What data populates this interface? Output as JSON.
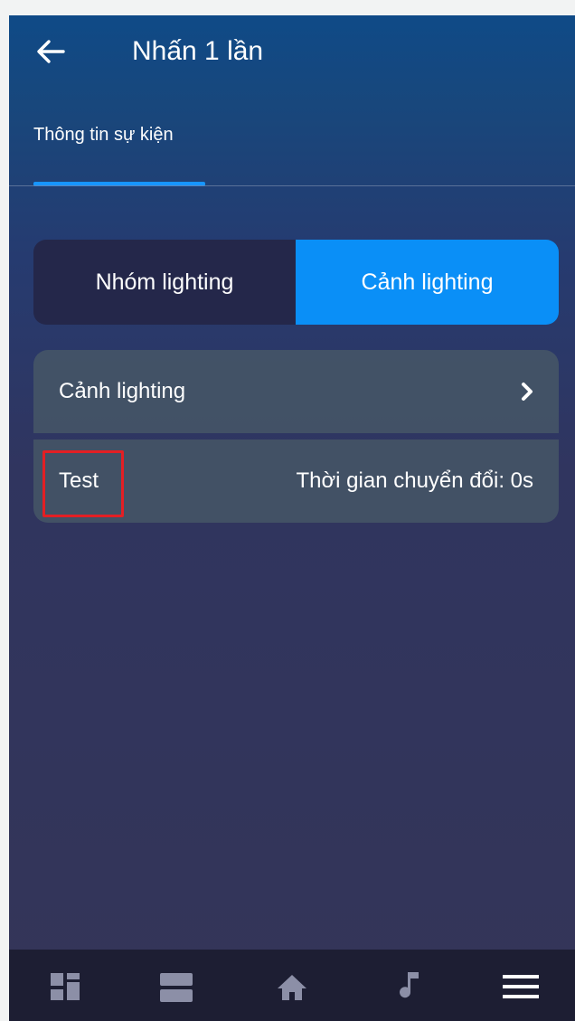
{
  "header": {
    "back_icon": "arrow-left-icon",
    "title": "Nhấn 1 lần"
  },
  "tabs": {
    "active_label": "Thông tin sự kiện"
  },
  "segment": {
    "left_label": "Nhóm lighting",
    "right_label": "Cảnh lighting",
    "selected": "right",
    "selected_color": "#0a8ff7"
  },
  "scene_list": {
    "row_label": "Cảnh lighting",
    "row_icon": "chevron-right-icon",
    "item_name": "Test",
    "item_detail": "Thời gian chuyển đổi: 0s"
  },
  "highlight": {
    "color": "#e31f24"
  },
  "bottom_nav": {
    "items": [
      "dashboard-icon",
      "rooms-icon",
      "home-icon",
      "music-icon",
      "menu-icon"
    ]
  },
  "colors": {
    "accent": "#1795ff",
    "nav_background": "#1d1e33"
  }
}
